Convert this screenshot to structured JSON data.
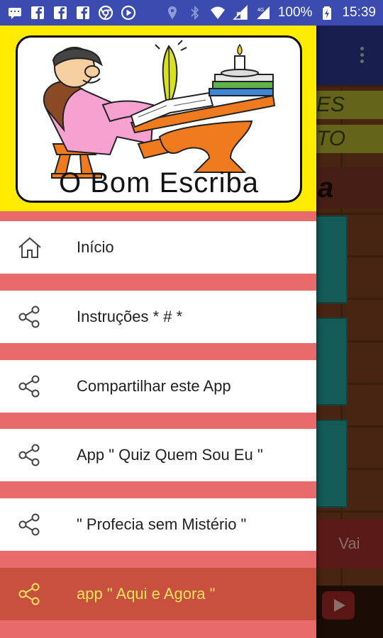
{
  "status_bar": {
    "battery_percent": "100%",
    "time": "15:39",
    "left_icons": [
      "chat-icon",
      "facebook-icon",
      "facebook-icon",
      "facebook-icon",
      "chrome-icon",
      "media-icon"
    ],
    "right_icons": [
      "location-icon",
      "bluetooth-icon",
      "wifi-icon",
      "signal-icon",
      "signal-4g-icon",
      "battery-charging-icon"
    ]
  },
  "background_app": {
    "banner_top_text": "ES",
    "banner_bottom_text": "TO",
    "big_text": "a",
    "go_button_label": "Vai"
  },
  "drawer": {
    "header_title": "O Bom Escriba",
    "items": [
      {
        "label": "Início",
        "icon": "home-icon"
      },
      {
        "label": "Instruções * # *",
        "icon": "share-icon"
      },
      {
        "label": "Compartilhar este App",
        "icon": "share-icon"
      },
      {
        "label": "App \" Quiz Quem Sou Eu \"",
        "icon": "share-icon"
      },
      {
        "label": "\" Profecia sem Mistério \"",
        "icon": "share-icon"
      },
      {
        "label": "app \" Aqui e Agora \"",
        "icon": "share-icon"
      }
    ]
  },
  "colors": {
    "status_bar": "#3b4bb0",
    "drawer_header": "#ffec00",
    "drawer_separator": "#e86a6a",
    "active_item_bg": "#c9503f",
    "active_item_text": "#f3e45a"
  }
}
